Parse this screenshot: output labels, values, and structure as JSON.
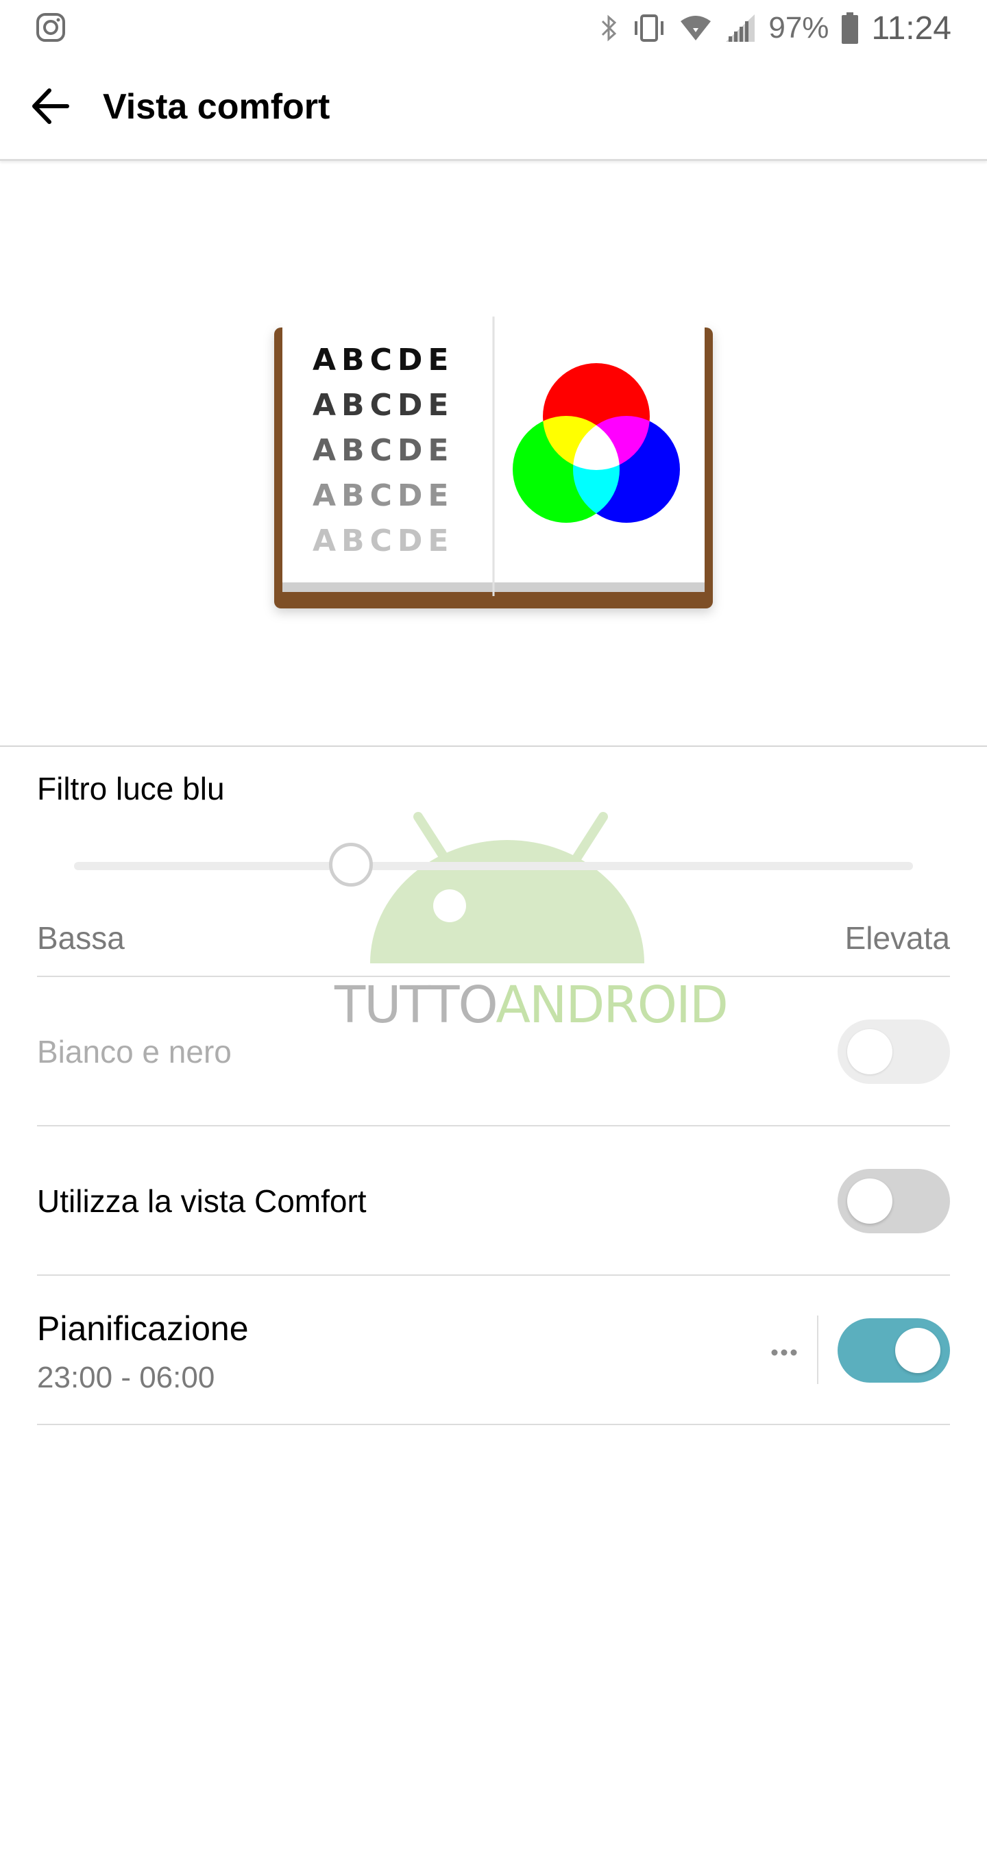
{
  "status_bar": {
    "icons": [
      "instagram-icon",
      "bluetooth-icon",
      "vibrate-icon",
      "wifi-icon",
      "signal-icon",
      "battery-icon"
    ],
    "battery": "97%",
    "time": "11:24"
  },
  "app_bar": {
    "back_icon": "arrow-left-icon",
    "title": "Vista comfort"
  },
  "illustration": {
    "rows": [
      "ABCDE",
      "ABCDE",
      "ABCDE",
      "ABCDE",
      "ABCDE"
    ],
    "circle_colors": [
      "#ff0000",
      "#00ff00",
      "#0000ff"
    ]
  },
  "blue_light": {
    "label": "Filtro luce blu",
    "slider_level": 0.33,
    "min_label": "Bassa",
    "max_label": "Elevata"
  },
  "settings": {
    "bw_label": "Bianco e nero",
    "bw_on": false,
    "bw_enabled": false,
    "comfort_label": "Utilizza la vista Comfort",
    "comfort_on": false,
    "schedule_label": "Pianificazione",
    "schedule_value": "23:00 - 06:00",
    "schedule_on": true
  },
  "watermark": {
    "part1": "TUTTO",
    "part2": "ANDROID"
  },
  "colors": {
    "accent": "#5bafbe",
    "toggle_off": "#d3d3d3",
    "book_cover": "#8b5a2b"
  }
}
